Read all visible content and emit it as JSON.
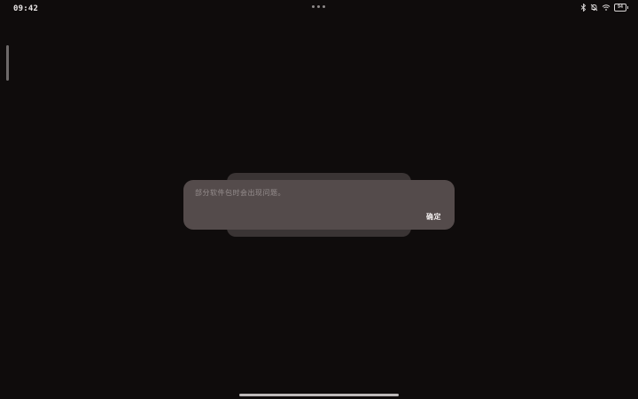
{
  "status_bar": {
    "time": "09:42",
    "battery_label": "94",
    "icons": [
      "bluetooth-icon",
      "mute-icon",
      "wifi-icon",
      "battery-icon"
    ]
  },
  "dialog": {
    "message": "部分软件包时会出现问题。",
    "ok_label": "确定"
  }
}
